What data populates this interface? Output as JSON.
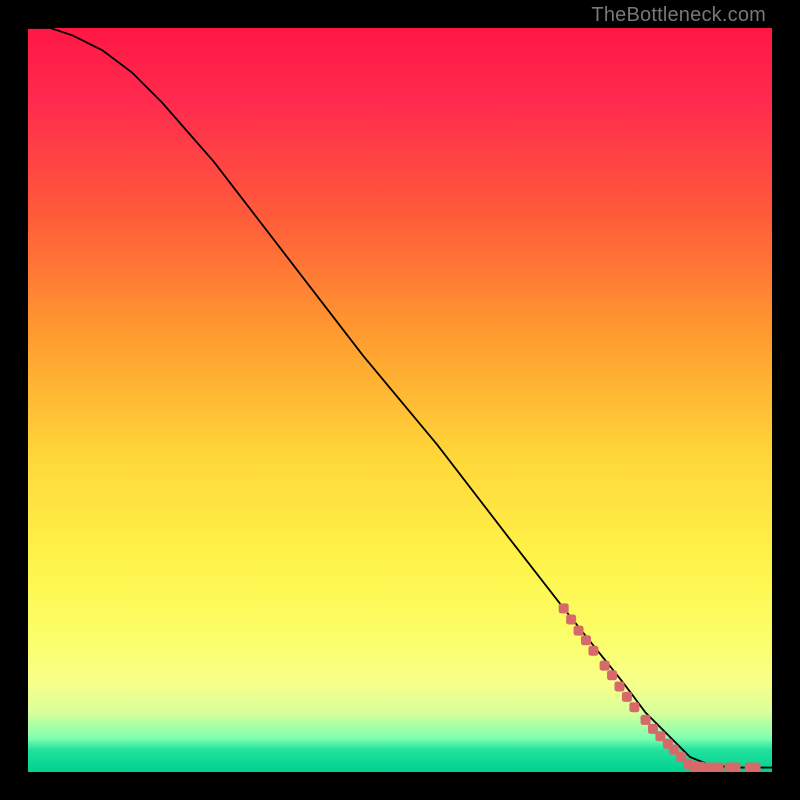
{
  "watermark": "TheBottleneck.com",
  "colors": {
    "background": "#000000",
    "curve": "#000000",
    "marker": "#d66a6a",
    "gradient_stops": [
      "#ff1744",
      "#ff5a3a",
      "#ff9e2f",
      "#ffd83a",
      "#fff44a",
      "#f8ff8a",
      "#7dffb0",
      "#00d090"
    ]
  },
  "chart_data": {
    "type": "line",
    "xlim": [
      0,
      100
    ],
    "ylim": [
      0,
      100
    ],
    "grid": false,
    "legend": false,
    "title": "",
    "xlabel": "",
    "ylabel": "",
    "series": [
      {
        "name": "bottleneck-curve",
        "x": [
          0,
          3,
          6,
          10,
          14,
          18,
          25,
          35,
          45,
          55,
          65,
          72,
          76,
          80,
          83,
          85,
          87,
          89,
          91,
          93,
          95,
          97,
          100
        ],
        "y": [
          100,
          100,
          99,
          97,
          94,
          90,
          82,
          69,
          56,
          44,
          31,
          22,
          17,
          12,
          8,
          6,
          4,
          2,
          1.2,
          0.8,
          0.6,
          0.6,
          0.6
        ]
      }
    ],
    "markers": {
      "name": "highlight-points",
      "points": [
        {
          "x": 72,
          "y": 22
        },
        {
          "x": 73,
          "y": 20.5
        },
        {
          "x": 74,
          "y": 19
        },
        {
          "x": 75,
          "y": 17.7
        },
        {
          "x": 76,
          "y": 16.3
        },
        {
          "x": 77.5,
          "y": 14.3
        },
        {
          "x": 78.5,
          "y": 13
        },
        {
          "x": 79.5,
          "y": 11.5
        },
        {
          "x": 80.5,
          "y": 10.1
        },
        {
          "x": 81.5,
          "y": 8.7
        },
        {
          "x": 83,
          "y": 7
        },
        {
          "x": 84,
          "y": 5.8
        },
        {
          "x": 85,
          "y": 4.8
        },
        {
          "x": 86,
          "y": 3.8
        },
        {
          "x": 86.8,
          "y": 3.0
        },
        {
          "x": 87.8,
          "y": 2.0
        },
        {
          "x": 88.7,
          "y": 1.1
        },
        {
          "x": 89.5,
          "y": 0.8
        },
        {
          "x": 90.3,
          "y": 0.7
        },
        {
          "x": 91.1,
          "y": 0.6
        },
        {
          "x": 92.0,
          "y": 0.6
        },
        {
          "x": 92.8,
          "y": 0.6
        },
        {
          "x": 94.3,
          "y": 0.6
        },
        {
          "x": 95.1,
          "y": 0.6
        },
        {
          "x": 97.0,
          "y": 0.6
        },
        {
          "x": 97.8,
          "y": 0.6
        }
      ]
    }
  }
}
